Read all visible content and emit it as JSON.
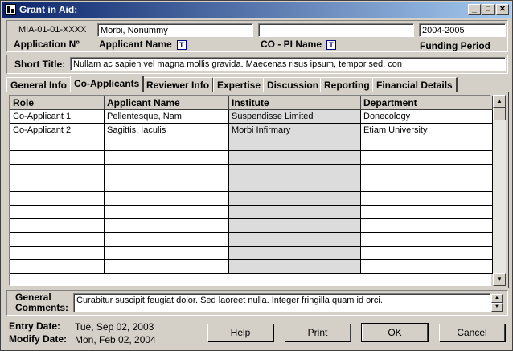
{
  "window": {
    "title": "Grant in Aid:"
  },
  "header": {
    "app_no_value": "MIA-01-01-XXXX",
    "app_no_label": "Application Nº",
    "applicant_value": "Morbi, Nonummy",
    "applicant_label": "Applicant Name",
    "copi_value": "",
    "copi_label": "CO - PI Name",
    "period_value": "2004-2005",
    "period_label": "Funding Period"
  },
  "short_title": {
    "label": "Short Title:",
    "value": "Nullam ac sapien vel magna mollis gravida. Maecenas risus ipsum, tempor sed, con"
  },
  "tabs": [
    {
      "label": "General Info"
    },
    {
      "label": "Co-Applicants"
    },
    {
      "label": "Reviewer Info"
    },
    {
      "label": "Expertise"
    },
    {
      "label": "Discussion"
    },
    {
      "label": "Reporting"
    },
    {
      "label": "Financial Details"
    }
  ],
  "table": {
    "headers": [
      "Role",
      "Applicant Name",
      "Institute",
      "Department"
    ],
    "rows": [
      [
        "Co-Applicant 1",
        "Pellentesque, Nam",
        "Suspendisse Limited",
        "Donecology"
      ],
      [
        "Co-Applicant 2",
        "Sagittis, Iaculis",
        "Morbi Infirmary",
        "Etiam University"
      ],
      [
        "",
        "",
        "",
        ""
      ],
      [
        "",
        "",
        "",
        ""
      ],
      [
        "",
        "",
        "",
        ""
      ],
      [
        "",
        "",
        "",
        ""
      ],
      [
        "",
        "",
        "",
        ""
      ],
      [
        "",
        "",
        "",
        ""
      ],
      [
        "",
        "",
        "",
        ""
      ],
      [
        "",
        "",
        "",
        ""
      ],
      [
        "",
        "",
        "",
        ""
      ],
      [
        "",
        "",
        "",
        ""
      ]
    ]
  },
  "comments": {
    "label": "General Comments:",
    "value": "Curabitur suscipit feugiat dolor. Sed laoreet nulla. Integer fringilla quam id orci."
  },
  "footer": {
    "entry_label": "Entry Date:",
    "entry_value": "Tue, Sep 02, 2003",
    "modify_label": "Modify Date:",
    "modify_value": "Mon, Feb 02, 2004"
  },
  "buttons": {
    "help": "Help",
    "print": "Print",
    "ok": "OK",
    "cancel": "Cancel"
  },
  "icons": {
    "app": "app-icon",
    "minimize": "minimize-icon",
    "maximize": "maximize-icon",
    "close": "close-icon",
    "lookup": "lookup-icon"
  },
  "colors": {
    "titlebar_start": "#0a246a",
    "titlebar_end": "#a6caf0",
    "face": "#d4d0c8"
  }
}
